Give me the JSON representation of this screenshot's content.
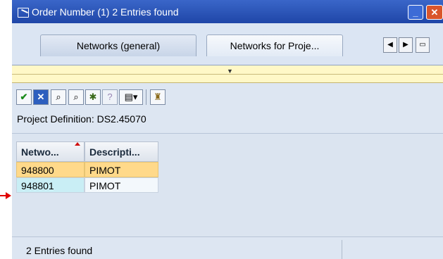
{
  "window": {
    "title": "Order Number (1)   2 Entries found"
  },
  "tabs": [
    {
      "label": "Networks (general)"
    },
    {
      "label": "Networks for Proje..."
    }
  ],
  "project_definition": "Project Definition: DS2.45070",
  "table": {
    "headers": [
      "Netwo...",
      "Descripti..."
    ],
    "rows": [
      [
        "948800",
        "PIMOT"
      ],
      [
        "948801",
        "PIMOT"
      ]
    ]
  },
  "status": {
    "text": "2 Entries found"
  },
  "colors": {
    "titlebar": "#2a55b8",
    "selected_row": "#ffd98a",
    "splitter": "#fff8c7",
    "marker_arrow": "#e00000"
  }
}
